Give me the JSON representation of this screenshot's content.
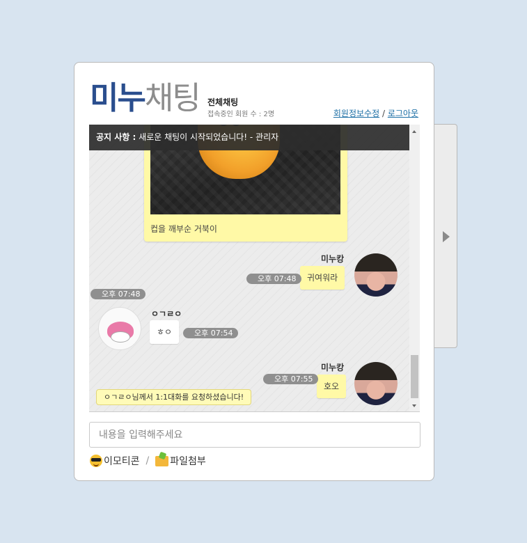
{
  "header": {
    "brand_part1": "미누",
    "brand_part2": "채팅",
    "room_name": "전체채팅",
    "users_online": "접속중인 회원 수 : 2명",
    "link_profile": "회원정보수정",
    "link_separator": "/",
    "link_logout": "로그아웃"
  },
  "notice": {
    "label": "공지 사항 :",
    "text": "새로운 채팅이 시작되었습니다! - 관리자"
  },
  "messages": [
    {
      "type": "image",
      "caption": "컵을 깨부순 거북이",
      "time": "오후 07:48"
    },
    {
      "type": "mine",
      "nick": "미누캉",
      "text": "귀여워라",
      "time": "오후 07:48"
    },
    {
      "type": "other",
      "nick": "ㅇㄱㄹㅇ",
      "text": "ㅎㅇ",
      "time": "오후 07:54"
    },
    {
      "type": "mine",
      "nick": "미누캉",
      "text": "호오",
      "time": "오후 07:55"
    }
  ],
  "request_notice": "ㅇㄱㄹㅇ님께서 1:1대화를 요청하셨습니다!",
  "input": {
    "placeholder": "내용을 입력해주세요",
    "value": ""
  },
  "tools": {
    "emoticon": "이모티콘",
    "separator": "/",
    "attach": "파일첨부"
  },
  "icons": [
    "emoticon-icon",
    "folder-icon",
    "expand-arrow-icon"
  ],
  "colors": {
    "brand_blue": "#2a4e8e",
    "bubble_yellow": "#fff9a6",
    "background": "#d8e4f0"
  }
}
